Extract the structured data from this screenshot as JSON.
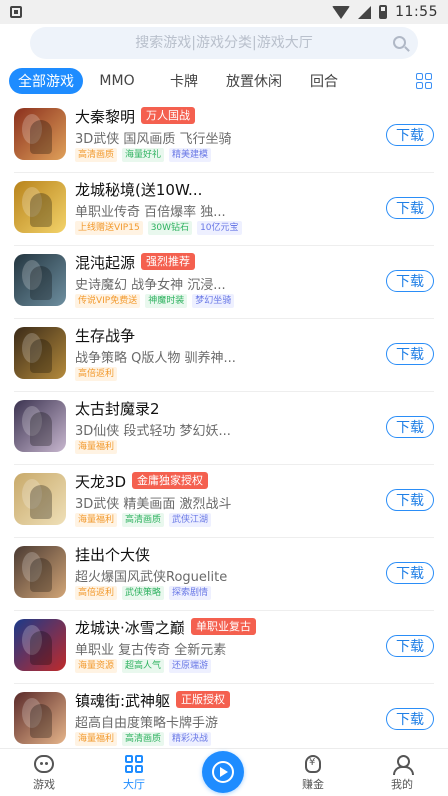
{
  "status_bar": {
    "time": "11:55"
  },
  "search": {
    "placeholder": "搜索游戏|游戏分类|游戏大厅"
  },
  "tabs": [
    {
      "label": "全部游戏",
      "active": true
    },
    {
      "label": "MMO",
      "active": false
    },
    {
      "label": "卡牌",
      "active": false
    },
    {
      "label": "放置休闲",
      "active": false
    },
    {
      "label": "回合",
      "active": false
    }
  ],
  "download_label": "下载",
  "colors": {
    "accent": "#1e8cff",
    "badge_red": "#f4604f",
    "badge_orange": "#fa8a3c"
  },
  "games": [
    {
      "name": "大秦黎明",
      "badge": "万人国战",
      "badge_color": "#f4604f",
      "desc": "3D武侠 国风画质 飞行坐骑",
      "tags": [
        "高清画质",
        "海量好礼",
        "精美建模"
      ],
      "thumb": [
        "#8a2f1d",
        "#e0a15a"
      ]
    },
    {
      "name": "龙城秘境(送10W...",
      "badge": "",
      "badge_color": "",
      "desc": "单职业传奇 百倍爆率 独...",
      "tags": [
        "上线赠送VIP15",
        "30W钻石",
        "10亿元宝"
      ],
      "thumb": [
        "#b8831c",
        "#f3d36a"
      ]
    },
    {
      "name": "混沌起源",
      "badge": "强烈推荐",
      "badge_color": "#f4604f",
      "desc": "史诗魔幻 战争女神 沉浸...",
      "tags": [
        "传说VIP免费送",
        "神魔时装",
        "梦幻坐骑"
      ],
      "thumb": [
        "#23353f",
        "#6e8fa0"
      ]
    },
    {
      "name": "生存战争",
      "badge": "",
      "badge_color": "",
      "desc": "战争策略 Q版人物 驯养神...",
      "tags": [
        "高倍返利"
      ],
      "thumb": [
        "#3a2a18",
        "#b58b3c"
      ]
    },
    {
      "name": "太古封魔录2",
      "badge": "",
      "badge_color": "",
      "desc": "3D仙侠 段式轻功 梦幻妖...",
      "tags": [
        "海量福利"
      ],
      "thumb": [
        "#3b3350",
        "#c8b7cf"
      ]
    },
    {
      "name": "天龙3D",
      "badge": "金庸独家授权",
      "badge_color": "#f4604f",
      "desc": "3D武侠 精美画面 激烈战斗",
      "tags": [
        "海量福利",
        "高清画质",
        "武侠江湖"
      ],
      "thumb": [
        "#c8a96a",
        "#efe0b8"
      ]
    },
    {
      "name": "挂出个大侠",
      "badge": "",
      "badge_color": "",
      "desc": "超火爆国风武侠Roguelite",
      "tags": [
        "高倍返利",
        "武侠策略",
        "探索剧情"
      ],
      "thumb": [
        "#4a3a32",
        "#d2a577"
      ]
    },
    {
      "name": "龙城诀·冰雪之巅",
      "badge": "单职业复古",
      "badge_color": "#f4604f",
      "desc": "单职业 复古传奇 全新元素",
      "tags": [
        "海量资源",
        "超高人气",
        "还原端游"
      ],
      "thumb": [
        "#1b3a8a",
        "#c02a2a"
      ]
    },
    {
      "name": "镇魂街:武神躯",
      "badge": "正版授权",
      "badge_color": "#f4604f",
      "desc": "超高自由度策略卡牌手游",
      "tags": [
        "海量福利",
        "高清画质",
        "精彩决战"
      ],
      "thumb": [
        "#5a2a2a",
        "#e6b58a"
      ]
    }
  ],
  "bottom_nav": [
    {
      "label": "游戏",
      "icon": "gamepad-icon",
      "active": false
    },
    {
      "label": "大厅",
      "icon": "grid-icon",
      "active": true
    },
    {
      "label": "",
      "icon": "play-icon",
      "active": false
    },
    {
      "label": "赚金",
      "icon": "money-bag-icon",
      "active": false
    },
    {
      "label": "我的",
      "icon": "user-icon",
      "active": false
    }
  ]
}
